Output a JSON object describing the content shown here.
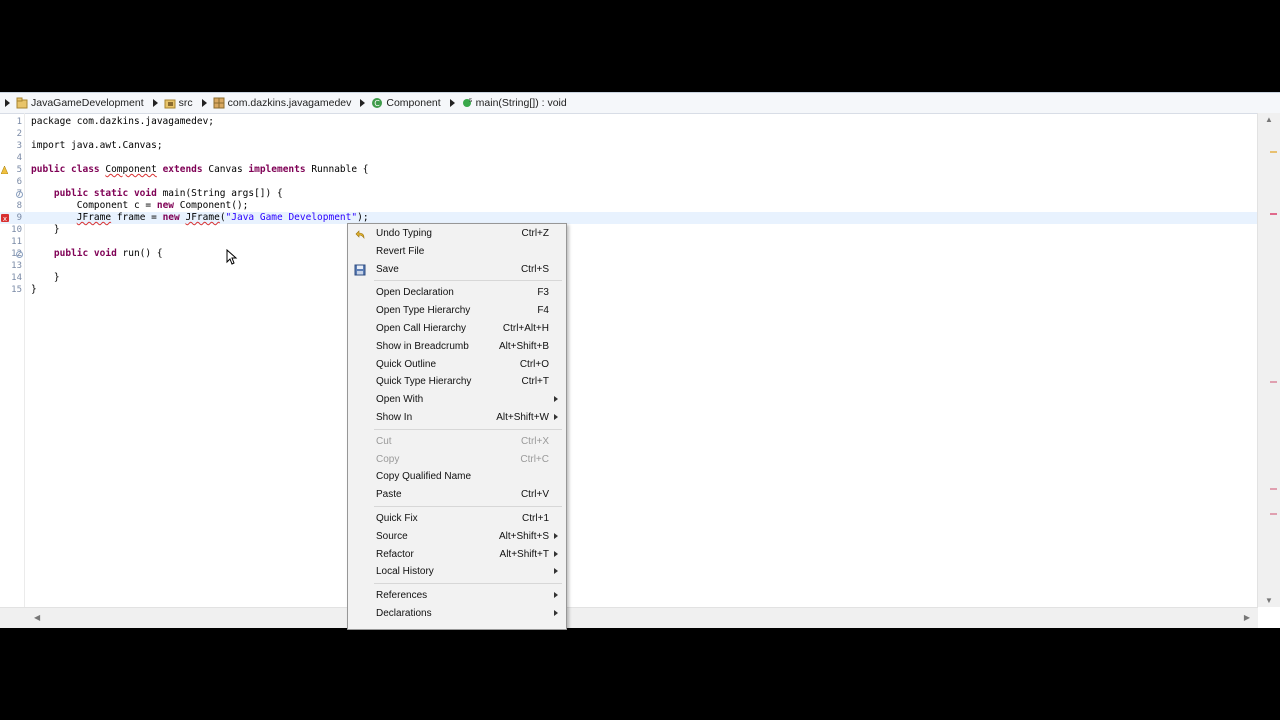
{
  "breadcrumb": {
    "items": [
      {
        "label": "JavaGameDevelopment",
        "icon": "project-icon"
      },
      {
        "label": "src",
        "icon": "source-folder-icon"
      },
      {
        "label": "com.dazkins.javagamedev",
        "icon": "package-icon"
      },
      {
        "label": "Component",
        "icon": "class-icon"
      },
      {
        "label": "main(String[]) : void",
        "icon": "method-icon"
      }
    ]
  },
  "code": {
    "lines": [
      {
        "n": "1",
        "segments": [
          {
            "t": "package com.dazkins.javagamedev;",
            "k": ""
          }
        ]
      },
      {
        "n": "2",
        "segments": []
      },
      {
        "n": "3",
        "segments": [
          {
            "t": "import java.awt.Canvas;",
            "k": ""
          }
        ]
      },
      {
        "n": "4",
        "segments": []
      },
      {
        "n": "5",
        "segments": [
          {
            "t": "public class ",
            "k": "kw"
          },
          {
            "t": "Component",
            "k": "ul"
          },
          {
            "t": " ",
            "k": ""
          },
          {
            "t": "extends",
            "k": "kw"
          },
          {
            "t": " Canvas ",
            "k": ""
          },
          {
            "t": "implements",
            "k": "kw"
          },
          {
            "t": " Runnable {",
            "k": ""
          }
        ]
      },
      {
        "n": "6",
        "segments": []
      },
      {
        "n": "7",
        "segments": [
          {
            "t": "    public static void ",
            "k": "kw"
          },
          {
            "t": "main(String args[]) {",
            "k": ""
          }
        ]
      },
      {
        "n": "8",
        "segments": [
          {
            "t": "        Component c = ",
            "k": ""
          },
          {
            "t": "new",
            "k": "kw"
          },
          {
            "t": " Component();",
            "k": ""
          }
        ]
      },
      {
        "n": "9",
        "segments": [
          {
            "t": "        ",
            "k": ""
          },
          {
            "t": "JFrame",
            "k": "ul"
          },
          {
            "t": " frame = ",
            "k": ""
          },
          {
            "t": "new",
            "k": "kw"
          },
          {
            "t": " ",
            "k": ""
          },
          {
            "t": "JFrame",
            "k": "ul"
          },
          {
            "t": "(",
            "k": ""
          },
          {
            "t": "\"Java Game Development\"",
            "k": "str"
          },
          {
            "t": ");",
            "k": ""
          }
        ]
      },
      {
        "n": "10",
        "segments": [
          {
            "t": "    }",
            "k": ""
          }
        ]
      },
      {
        "n": "11",
        "segments": []
      },
      {
        "n": "12",
        "segments": [
          {
            "t": "    public void ",
            "k": "kw"
          },
          {
            "t": "run() {",
            "k": ""
          }
        ]
      },
      {
        "n": "13",
        "segments": []
      },
      {
        "n": "14",
        "segments": [
          {
            "t": "    }",
            "k": ""
          }
        ]
      },
      {
        "n": "15",
        "segments": [
          {
            "t": "}",
            "k": ""
          }
        ]
      }
    ]
  },
  "menu": {
    "items": [
      {
        "type": "item",
        "label": "Undo Typing",
        "shortcut": "Ctrl+Z",
        "icon": "undo-icon",
        "enabled": true
      },
      {
        "type": "item",
        "label": "Revert File",
        "shortcut": "",
        "enabled": true
      },
      {
        "type": "item",
        "label": "Save",
        "shortcut": "Ctrl+S",
        "icon": "save-icon",
        "enabled": true
      },
      {
        "type": "sep"
      },
      {
        "type": "item",
        "label": "Open Declaration",
        "shortcut": "F3",
        "enabled": true
      },
      {
        "type": "item",
        "label": "Open Type Hierarchy",
        "shortcut": "F4",
        "enabled": true
      },
      {
        "type": "item",
        "label": "Open Call Hierarchy",
        "shortcut": "Ctrl+Alt+H",
        "enabled": true
      },
      {
        "type": "item",
        "label": "Show in Breadcrumb",
        "shortcut": "Alt+Shift+B",
        "enabled": true
      },
      {
        "type": "item",
        "label": "Quick Outline",
        "shortcut": "Ctrl+O",
        "enabled": true
      },
      {
        "type": "item",
        "label": "Quick Type Hierarchy",
        "shortcut": "Ctrl+T",
        "enabled": true
      },
      {
        "type": "item",
        "label": "Open With",
        "shortcut": "",
        "submenu": true,
        "enabled": true
      },
      {
        "type": "item",
        "label": "Show In",
        "shortcut": "Alt+Shift+W",
        "submenu": true,
        "enabled": true
      },
      {
        "type": "sep"
      },
      {
        "type": "item",
        "label": "Cut",
        "shortcut": "Ctrl+X",
        "enabled": false
      },
      {
        "type": "item",
        "label": "Copy",
        "shortcut": "Ctrl+C",
        "enabled": false
      },
      {
        "type": "item",
        "label": "Copy Qualified Name",
        "shortcut": "",
        "enabled": true
      },
      {
        "type": "item",
        "label": "Paste",
        "shortcut": "Ctrl+V",
        "enabled": true
      },
      {
        "type": "sep"
      },
      {
        "type": "item",
        "label": "Quick Fix",
        "shortcut": "Ctrl+1",
        "enabled": true
      },
      {
        "type": "item",
        "label": "Source",
        "shortcut": "Alt+Shift+S",
        "submenu": true,
        "enabled": true
      },
      {
        "type": "item",
        "label": "Refactor",
        "shortcut": "Alt+Shift+T",
        "submenu": true,
        "enabled": true
      },
      {
        "type": "item",
        "label": "Local History",
        "shortcut": "",
        "submenu": true,
        "enabled": true
      },
      {
        "type": "sep"
      },
      {
        "type": "item",
        "label": "References",
        "shortcut": "",
        "submenu": true,
        "enabled": true
      },
      {
        "type": "item",
        "label": "Declarations",
        "shortcut": "",
        "submenu": true,
        "enabled": true
      }
    ]
  },
  "colors": {
    "keyword": "#7f0055",
    "string": "#2a00ff",
    "current_line": "#e8f2fe",
    "error": "#d83030"
  }
}
